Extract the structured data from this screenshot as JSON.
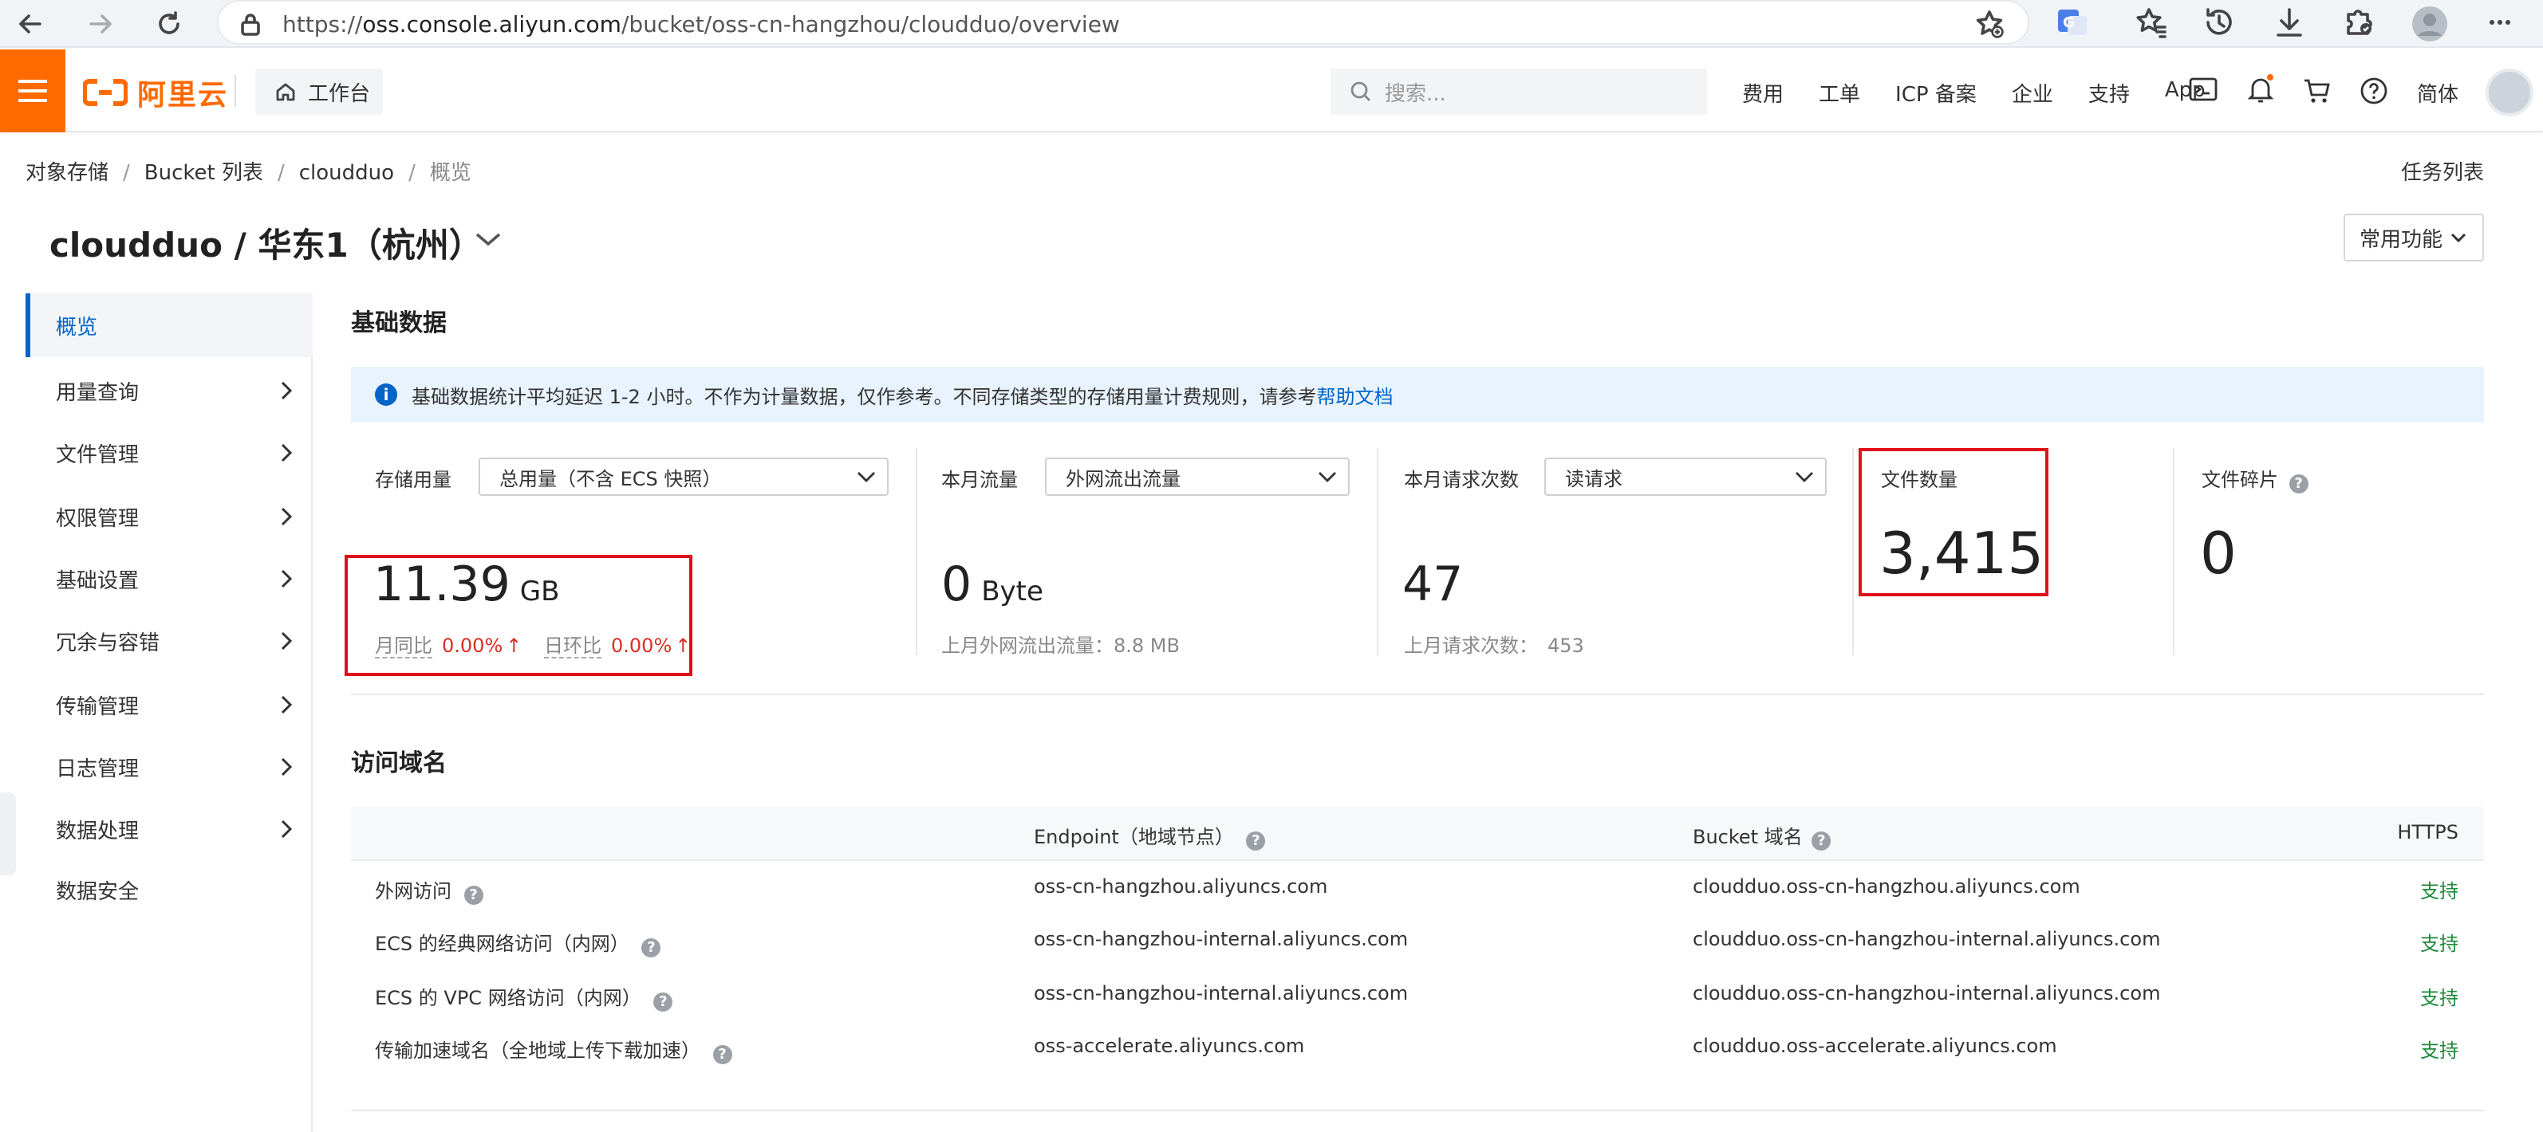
{
  "browser": {
    "url_scheme": "https://",
    "url_host": "oss.console.aliyun.com",
    "url_path": "/bucket/oss-cn-hangzhou/cloudduo/overview"
  },
  "topnav": {
    "logo_text": "阿里云",
    "workbench": "工作台",
    "search_placeholder": "搜索...",
    "links": [
      "费用",
      "工单",
      "ICP 备案",
      "企业",
      "支持",
      "App"
    ],
    "lang": "简体"
  },
  "breadcrumb": {
    "items": [
      "对象存储",
      "Bucket 列表",
      "cloudduo"
    ],
    "current": "概览"
  },
  "task_list": "任务列表",
  "page_title": "cloudduo / 华东1（杭州）",
  "common_functions": "常用功能",
  "sidebar": {
    "items": [
      {
        "label": "概览",
        "active": true
      },
      {
        "label": "用量查询"
      },
      {
        "label": "文件管理"
      },
      {
        "label": "权限管理"
      },
      {
        "label": "基础设置"
      },
      {
        "label": "冗余与容错"
      },
      {
        "label": "传输管理"
      },
      {
        "label": "日志管理"
      },
      {
        "label": "数据处理"
      },
      {
        "label": "数据安全"
      }
    ]
  },
  "basic_data": {
    "title": "基础数据",
    "notice": "基础数据统计平均延迟 1-2 小时。不作为计量数据，仅作参考。不同存储类型的存储用量计费规则，请参考",
    "notice_link": "帮助文档",
    "storage": {
      "label": "存储用量",
      "select": "总用量（不含 ECS 快照）",
      "value": "11.39",
      "unit": "GB",
      "mom_label": "月同比",
      "mom_value": "0.00%",
      "dod_label": "日环比",
      "dod_value": "0.00%",
      "arrow": "↑"
    },
    "traffic": {
      "label": "本月流量",
      "select": "外网流出流量",
      "value": "0",
      "unit": "Byte",
      "sub": "上月外网流出流量：8.8 MB"
    },
    "requests": {
      "label": "本月请求次数",
      "select": "读请求",
      "value": "47",
      "sub_label": "上月请求次数：",
      "sub_value": "453"
    },
    "files": {
      "label": "文件数量",
      "value": "3,415"
    },
    "fragments": {
      "label": "文件碎片",
      "value": "0"
    }
  },
  "domains": {
    "title": "访问域名",
    "headers": [
      "Endpoint（地域节点）",
      "Bucket 域名",
      "HTTPS"
    ],
    "rows": [
      {
        "name": "外网访问",
        "endpoint": "oss-cn-hangzhou.aliyuncs.com",
        "bucket": "cloudduo.oss-cn-hangzhou.aliyuncs.com",
        "https": "支持"
      },
      {
        "name": "ECS 的经典网络访问（内网）",
        "endpoint": "oss-cn-hangzhou-internal.aliyuncs.com",
        "bucket": "cloudduo.oss-cn-hangzhou-internal.aliyuncs.com",
        "https": "支持"
      },
      {
        "name": "ECS 的 VPC 网络访问（内网）",
        "endpoint": "oss-cn-hangzhou-internal.aliyuncs.com",
        "bucket": "cloudduo.oss-cn-hangzhou-internal.aliyuncs.com",
        "https": "支持"
      },
      {
        "name": "传输加速域名（全地域上传下载加速）",
        "endpoint": "oss-accelerate.aliyuncs.com",
        "bucket": "cloudduo.oss-accelerate.aliyuncs.com",
        "https": "支持"
      }
    ]
  },
  "colors": {
    "brand": "#ff6a00",
    "primary": "#0064c8",
    "highlight": "#e0101a",
    "success": "#1b8a3a",
    "danger": "#d93026"
  }
}
